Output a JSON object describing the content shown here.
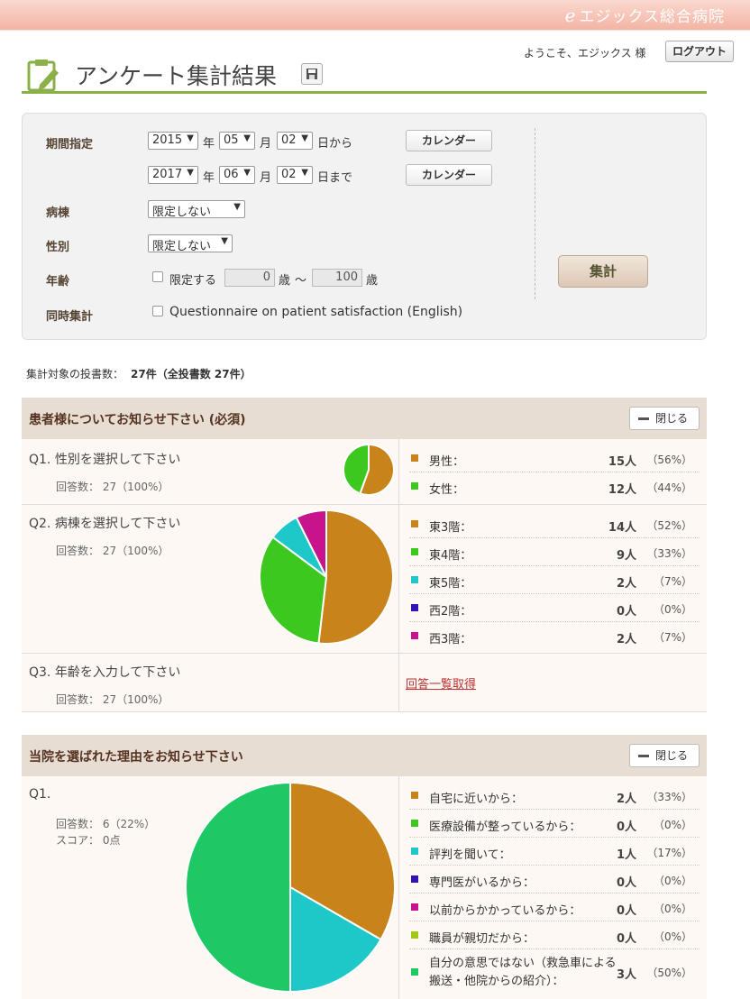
{
  "header": {
    "brand_mark": "e",
    "brand_name": "エジックス総合病院"
  },
  "user": {
    "welcome": "ようこそ、エジックス 様",
    "logout_label": "ログアウト"
  },
  "page": {
    "title": "アンケート集計結果"
  },
  "filter": {
    "period_label": "期間指定",
    "from": {
      "year": "2015",
      "month": "05",
      "day": "02",
      "suffix": "日から"
    },
    "to": {
      "year": "2017",
      "month": "06",
      "day": "02",
      "suffix": "日まで"
    },
    "year_unit": "年",
    "month_unit": "月",
    "calendar_label": "カレンダー",
    "ward_label": "病棟",
    "ward_value": "限定しない",
    "gender_label": "性別",
    "gender_value": "限定しない",
    "age_label": "年齢",
    "age_limit_label": "限定する",
    "age_min": "0",
    "age_max": "100",
    "age_unit": "歳",
    "age_sep": "～",
    "simul_label": "同時集計",
    "simul_option": "Questionnaire on patient satisfaction (English)",
    "aggregate_label": "集計"
  },
  "summary": {
    "label": "集計対象の投書数：",
    "value": "27件（全投書数 27件）"
  },
  "sections": [
    {
      "title": "患者様についてお知らせ下さい (必須)",
      "close_label": "閉じる",
      "questions": [
        {
          "title": "Q1. 性別を選択して下さい",
          "answers": "回答数： 27（100%）",
          "items": [
            {
              "label": "男性：",
              "count": "15人",
              "pct": "（56%）",
              "color": "#c8841a"
            },
            {
              "label": "女性：",
              "count": "12人",
              "pct": "（44%）",
              "color": "#3cc81e"
            }
          ]
        },
        {
          "title": "Q2. 病棟を選択して下さい",
          "answers": "回答数： 27（100%）",
          "items": [
            {
              "label": "東3階：",
              "count": "14人",
              "pct": "（52%）",
              "color": "#c8841a"
            },
            {
              "label": "東4階：",
              "count": "9人",
              "pct": "（33%）",
              "color": "#3cc81e"
            },
            {
              "label": "東5階：",
              "count": "2人",
              "pct": "（7%）",
              "color": "#1ec8c8"
            },
            {
              "label": "西2階：",
              "count": "0人",
              "pct": "（0%）",
              "color": "#3214b4"
            },
            {
              "label": "西3階：",
              "count": "2人",
              "pct": "（7%）",
              "color": "#c8148c"
            }
          ]
        },
        {
          "title": "Q3. 年齢を入力して下さい",
          "answers": "回答数： 27（100%）",
          "link": "回答一覧取得"
        }
      ]
    },
    {
      "title": "当院を選ばれた理由をお知らせ下さい",
      "close_label": "閉じる",
      "questions": [
        {
          "title": "Q1.",
          "answers": "回答数： 6（22%）",
          "score": "スコア： 0点",
          "items": [
            {
              "label": "自宅に近いから：",
              "count": "2人",
              "pct": "（33%）",
              "color": "#c8841a"
            },
            {
              "label": "医療設備が整っているから：",
              "count": "0人",
              "pct": "（0%）",
              "color": "#3cc81e"
            },
            {
              "label": "評判を聞いて：",
              "count": "1人",
              "pct": "（17%）",
              "color": "#1ec8c8"
            },
            {
              "label": "専門医がいるから：",
              "count": "0人",
              "pct": "（0%）",
              "color": "#3214b4"
            },
            {
              "label": "以前からかかっているから：",
              "count": "0人",
              "pct": "（0%）",
              "color": "#c8148c"
            },
            {
              "label": "職員が親切だから：",
              "count": "0人",
              "pct": "（0%）",
              "color": "#a0c814"
            },
            {
              "label": "自分の意思ではない（救急車による搬送・他院からの紹介）：",
              "count": "3人",
              "pct": "（50%）",
              "color": "#1ec864"
            }
          ]
        }
      ]
    }
  ],
  "chart_data": [
    {
      "type": "pie",
      "categories": [
        "男性",
        "女性"
      ],
      "values": [
        15,
        12
      ]
    },
    {
      "type": "pie",
      "categories": [
        "東3階",
        "東4階",
        "東5階",
        "西2階",
        "西3階"
      ],
      "values": [
        14,
        9,
        2,
        0,
        2
      ]
    },
    {
      "type": "pie",
      "categories": [
        "自宅に近いから",
        "医療設備が整っているから",
        "評判を聞いて",
        "専門医がいるから",
        "以前からかかっているから",
        "職員が親切だから",
        "自分の意思ではない（救急車による搬送・他院からの紹介）"
      ],
      "values": [
        2,
        0,
        1,
        0,
        0,
        0,
        3
      ]
    }
  ]
}
